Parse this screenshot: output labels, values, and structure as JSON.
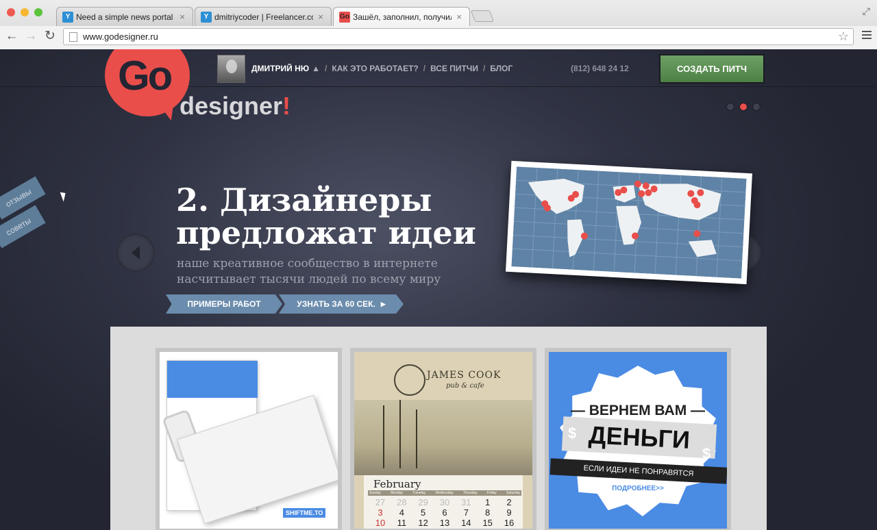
{
  "browser": {
    "tabs": [
      {
        "title": "Need a simple news portal in",
        "close": "×",
        "icon": "freelancer-icon"
      },
      {
        "title": "dmitriycoder | Freelancer.co",
        "close": "×",
        "icon": "freelancer-icon"
      },
      {
        "title": "Зашёл, заполнил, получил.",
        "close": "×",
        "icon": "godesigner-icon",
        "active": true
      }
    ],
    "url": "www.godesigner.ru"
  },
  "site": {
    "logo": {
      "go": "Go",
      "designer": "designer",
      "bang": "!"
    },
    "nav": {
      "user": "ДМИТРИЙ НЮ",
      "user_caret": "▲",
      "sep": "/",
      "items": [
        "КАК ЭТО РАБОТАЕТ?",
        "ВСЕ ПИТЧИ",
        "БЛОГ"
      ]
    },
    "phone": "(812) 648 24 12",
    "cta": "СОЗДАТЬ ПИТЧ",
    "side_tabs": [
      "отзывы",
      "советы"
    ],
    "slider": {
      "headline_1": "2. Дизайнеры",
      "headline_2": "предложат идеи",
      "sub_1": "наше креативное сообщество в интернете",
      "sub_2": "насчитывает тысячи людей по всему миру",
      "btn_examples": "ПРИМЕРЫ РАБОТ",
      "btn_learn": "УЗНАТЬ ЗА 60 СЕК.",
      "btn_learn_icon": "▶",
      "active_dot": 1,
      "dot_count": 3
    },
    "gallery": {
      "card1": {
        "brand": "SHIFTME.TO"
      },
      "card2": {
        "title": "JAMES COOK",
        "subtitle": "pub & cafe",
        "month": "February",
        "weekdays": [
          "Sunday",
          "Monday",
          "Tuesday",
          "Wednesday",
          "Thursday",
          "Friday",
          "Saturday"
        ],
        "rows": [
          [
            "27",
            "28",
            "29",
            "30",
            "31",
            "1",
            "2"
          ],
          [
            "3",
            "4",
            "5",
            "6",
            "7",
            "8",
            "9"
          ],
          [
            "10",
            "11",
            "12",
            "13",
            "14",
            "15",
            "16"
          ]
        ]
      },
      "card3": {
        "top": "— ВЕРНЕМ ВАМ —",
        "money": "ДЕНЬГИ",
        "dollar": "$",
        "strip": "ЕСЛИ ИДЕИ НЕ ПОНРАВЯТСЯ",
        "more": "ПОДРОБНЕЕ>>"
      }
    }
  },
  "colors": {
    "brand_red": "#e94e4b",
    "cta_green": "#5e9155",
    "ribbon_blue": "#6b8cac",
    "bg_dark": "#252734"
  }
}
